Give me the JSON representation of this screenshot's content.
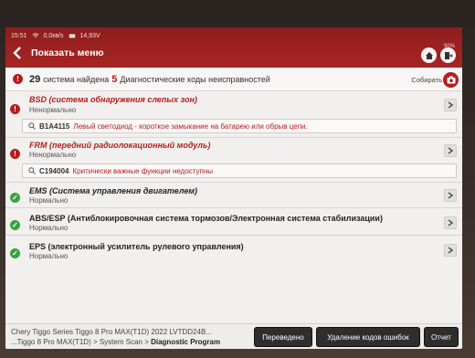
{
  "status_bar": {
    "time": "15:51",
    "speed": "0,0кв/s",
    "voltage": "14,93V",
    "battery": "90%"
  },
  "header": {
    "back_label": "Показать меню"
  },
  "summary": {
    "systems_count": "29",
    "systems_text": "система найдена",
    "dtc_count": "5",
    "dtc_text": "Диагностические коды неисправностей",
    "collect_label": "Собирать"
  },
  "systems": [
    {
      "name": "BSD (система обнаружения слепых зон)",
      "state": "Ненормально",
      "status": "error",
      "dtc": {
        "code": "B1A4115",
        "description": "Левый светодиод - короткое замыкание на батарею или обрыв цепи."
      }
    },
    {
      "name": "FRM (передний радиолокационный модуль)",
      "state": "Ненормально",
      "status": "error",
      "dtc": {
        "code": "C194004",
        "description": "Критически важные функции недоступны"
      }
    },
    {
      "name": "EMS (Система управления двигателем)",
      "state": "Нормально",
      "status": "ok"
    },
    {
      "name": "ABS/ESP (Антиблокировочная система тормозов/Электронная система стабилизации)",
      "state": "Нормально",
      "status": "ok"
    },
    {
      "name": "EPS (электронный усилитель рулевого управления)",
      "state": "Нормально",
      "status": "ok"
    }
  ],
  "footer": {
    "vehicle": "Chery  Tiggo Series Tiggo 8 Pro MAX(T1D) 2022  LVTDD24B...",
    "path_prefix": "...Tiggo 8 Pro MAX(T1D) > System Scan > ",
    "path_current": "Diagnostic Program",
    "translated_label": "Переведено",
    "clear_codes_label": "Удаление кодов ошибок",
    "report_label": "Отчет"
  },
  "colors": {
    "accent": "#a82424",
    "error": "#b31e1e",
    "ok": "#3aa043"
  }
}
